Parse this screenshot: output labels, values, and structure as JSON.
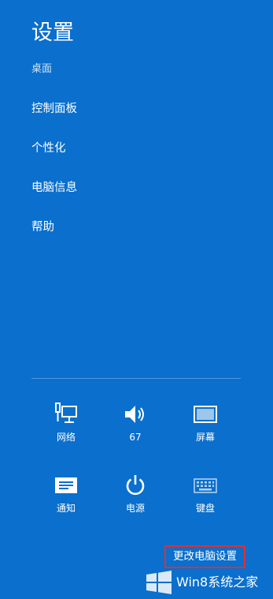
{
  "panel": {
    "title": "设置",
    "subtitle": "桌面"
  },
  "menu": [
    {
      "label": "控制面板"
    },
    {
      "label": "个性化"
    },
    {
      "label": "电脑信息"
    },
    {
      "label": "帮助"
    }
  ],
  "quick_settings": [
    {
      "label": "网络",
      "icon": "network-icon"
    },
    {
      "label": "67",
      "icon": "volume-icon"
    },
    {
      "label": "屏幕",
      "icon": "screen-icon"
    },
    {
      "label": "通知",
      "icon": "notifications-icon"
    },
    {
      "label": "电源",
      "icon": "power-icon"
    },
    {
      "label": "键盘",
      "icon": "keyboard-icon"
    }
  ],
  "change_settings_label": "更改电脑设置",
  "watermark": {
    "text": "Win8系统之家",
    "icon": "windows-logo-icon"
  },
  "colors": {
    "background": "#0a6fcd",
    "highlight_border": "#e03030"
  }
}
